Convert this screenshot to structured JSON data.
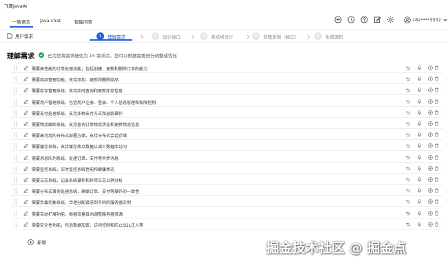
{
  "app": {
    "title": "飞算JavaAI"
  },
  "tabs": [
    {
      "label": "一致语言",
      "active": true
    },
    {
      "label": "Java chat",
      "active": false
    },
    {
      "label": "智能问答",
      "active": false
    }
  ],
  "toolbar_icons": [
    "plus-circle-icon",
    "history-icon",
    "help-icon",
    "edit-icon",
    "settings-icon"
  ],
  "user": {
    "name": "182****3532",
    "icon": "user-icon"
  },
  "stepbar": {
    "back_label": "用户需求",
    "steps": [
      {
        "num": "1",
        "label": "理解需求",
        "active": true
      },
      {
        "num": "2",
        "label": "设计接口",
        "active": false
      },
      {
        "num": "3",
        "label": "表结构设计",
        "active": false
      },
      {
        "num": "4",
        "label": "处理逻辑（接口）",
        "active": false
      },
      {
        "num": "5",
        "label": "生成源码",
        "active": false
      }
    ]
  },
  "section": {
    "title": "理解需求",
    "status": "已为您将需求细化为 15 需求点，您可以根据需要进行调整或优化"
  },
  "requirements": [
    "需要高性能的订单处理功能，包括创建、更新和删除订单的能力",
    "需要商品管理功能，支持添加、更新和删除商品",
    "需要库存管理系统，支持实时查询和更新库存信息",
    "需要用户管理系统，包括用户注册、登录、个人信息管理和权限控制",
    "需要支付处理系统，支持多种支付方式和退款操作",
    "需要物流跟踪系统，支持查询订单物流状态和更新物流信息",
    "需要高可用的分布式部署方案，支持分布式会话存储",
    "需要缓存系统，支持缓存热点数据以减少数据库访问",
    "需要消息队列系统，处理订单、支付等异步消息",
    "需要监控系统，实时监控系统性能和健康状态",
    "需要日志系统，记录系统操作和异常日志以供分析",
    "需要分布式事务处理系统，确保订单、支付等操作的一致性",
    "需要负载均衡系统，合理分配请求到不同的服务器实例",
    "需要自动扩展功能，根据流量自动调整服务器资源",
    "需要安全性功能，包括数据加密、访问控制和防止SQL注入等"
  ],
  "row_icons": [
    "undo-icon",
    "microphone-icon",
    "add-icon",
    "delete-icon"
  ],
  "add_label": "新增",
  "watermark": "掘金技术社区 @ 掘金点",
  "colors": {
    "accent": "#1f5fd6",
    "success": "#22a854"
  }
}
